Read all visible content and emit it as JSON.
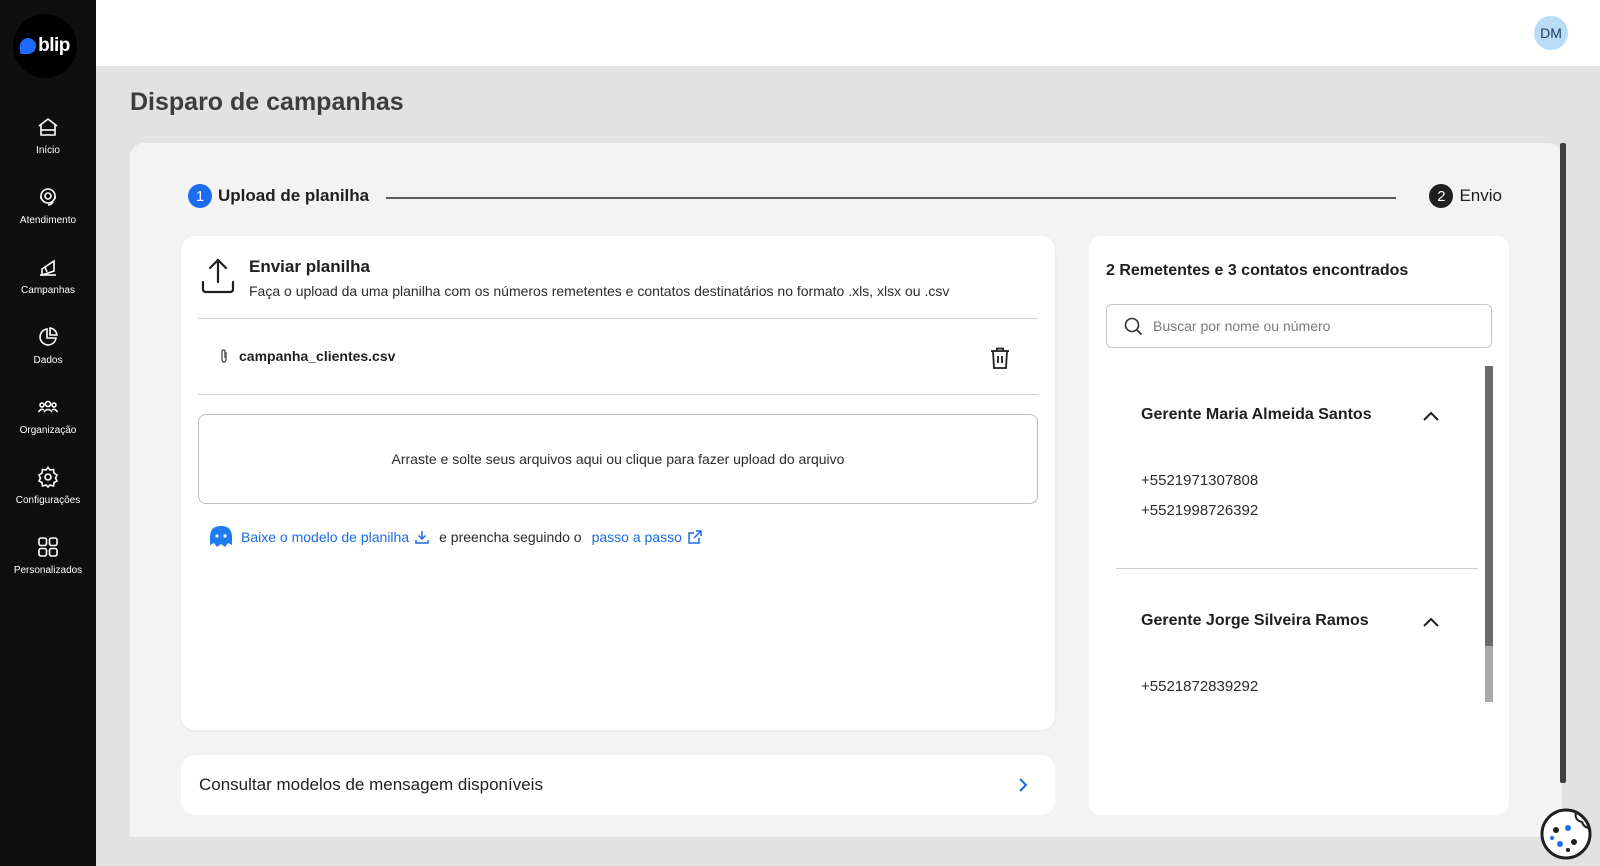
{
  "app": {
    "logo_text": "blip"
  },
  "sidebar": {
    "items": [
      {
        "label": "Início",
        "icon": "home-icon"
      },
      {
        "label": "Atendimento",
        "icon": "headset-icon"
      },
      {
        "label": "Campanhas",
        "icon": "megaphone-icon"
      },
      {
        "label": "Dados",
        "icon": "pie-chart-icon"
      },
      {
        "label": "Organização",
        "icon": "people-icon"
      },
      {
        "label": "Configurações",
        "icon": "gear-icon"
      },
      {
        "label": "Personalizados",
        "icon": "grid-icon"
      }
    ]
  },
  "header": {
    "avatar_initials": "DM"
  },
  "page": {
    "title": "Disparo de campanhas"
  },
  "stepper": {
    "steps": [
      {
        "number": "1",
        "label": "Upload de planilha",
        "active": true
      },
      {
        "number": "2",
        "label": "Envio",
        "active": false
      }
    ]
  },
  "upload": {
    "title": "Enviar planilha",
    "description": "Faça o upload da uma planilha com os números remetentes e contatos destinatários no formato .xls, xlsx ou .csv",
    "file_name": "campanha_clientes.csv",
    "dropzone_text": "Arraste e solte seus arquivos aqui ou clique para fazer upload do arquivo",
    "download_link": "Baixe o modelo de planilha",
    "middle_text": "e preencha seguindo o",
    "guide_link": "passo a passo"
  },
  "models": {
    "label": "Consultar modelos de mensagem disponíveis"
  },
  "senders": {
    "title": "2 Remetentes e 3 contatos encontrados",
    "search_placeholder": "Buscar por nome ou número",
    "groups": [
      {
        "name": "Gerente Maria Almeida Santos",
        "phones": [
          "+5521971307808",
          "+5521998726392"
        ]
      },
      {
        "name": "Gerente Jorge Silveira Ramos",
        "phones": [
          "+5521872839292"
        ]
      }
    ]
  },
  "colors": {
    "accent": "#1c6cf0",
    "sidebar_bg": "#0f0f0f",
    "link": "#1a6ce8"
  }
}
